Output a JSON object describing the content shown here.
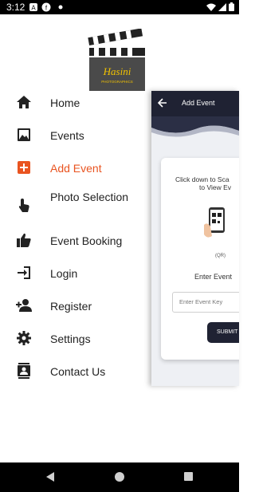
{
  "status_bar": {
    "time": "3:12",
    "left_icons": [
      "a-icon",
      "f-icon",
      "dot-icon"
    ],
    "right_icons": [
      "wifi-icon",
      "signal-icon",
      "battery-icon"
    ]
  },
  "drawer": {
    "logo_text": "Hasini",
    "logo_subtext": "PHOTOGRAPHICS",
    "items": [
      {
        "label": "Home",
        "icon": "home-icon",
        "active": false
      },
      {
        "label": "Events",
        "icon": "image-icon",
        "active": false
      },
      {
        "label": "Add Event",
        "icon": "add-box-icon",
        "active": true
      },
      {
        "label": "Photo Selection",
        "icon": "touch-icon",
        "active": false
      },
      {
        "label": "Event Booking",
        "icon": "thumbs-up-icon",
        "active": false
      },
      {
        "label": "Login",
        "icon": "login-icon",
        "active": false
      },
      {
        "label": "Register",
        "icon": "person-add-icon",
        "active": false
      },
      {
        "label": "Settings",
        "icon": "gear-icon",
        "active": false
      },
      {
        "label": "Contact Us",
        "icon": "contacts-icon",
        "active": false
      }
    ]
  },
  "screen": {
    "title": "Add Event",
    "instruction_line1": "Click down to Sca",
    "instruction_line2": "to View Ev",
    "qr_caption": "(QR)",
    "enter_label": "Enter Event",
    "input_placeholder": "Enter Event Key",
    "submit_label": "SUBMIT"
  },
  "colors": {
    "accent": "#e95420",
    "app_bar": "#1f2233",
    "text": "#222222"
  }
}
